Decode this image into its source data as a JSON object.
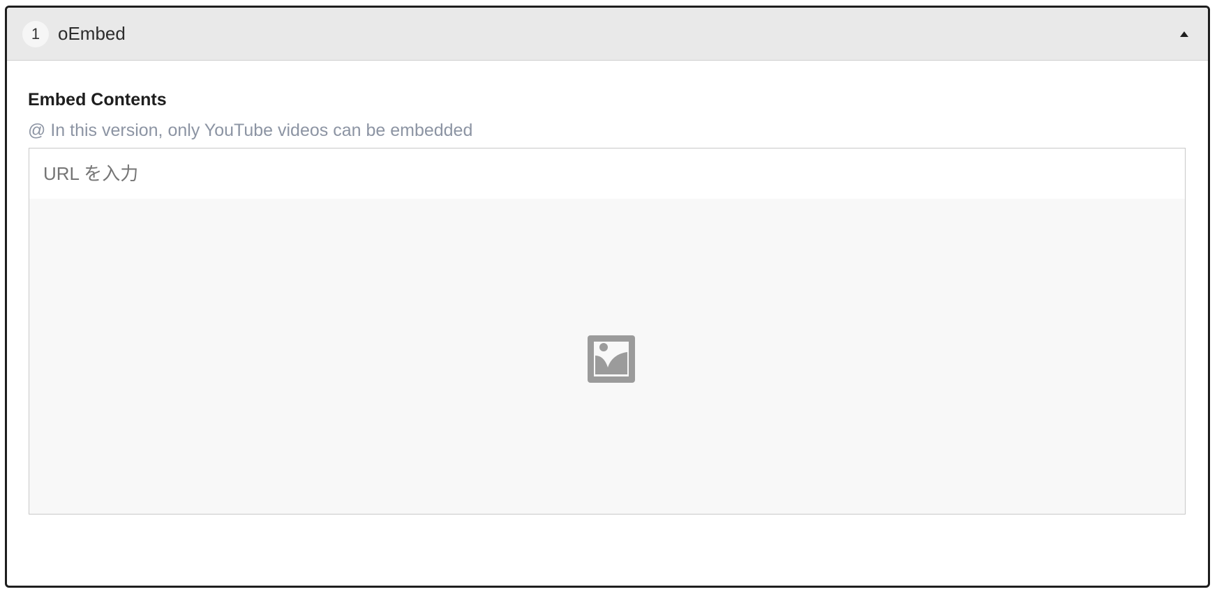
{
  "panel": {
    "index": "1",
    "title": "oEmbed",
    "toggle_icon": "triangle-up-icon"
  },
  "field": {
    "label": "Embed Contents",
    "help": "@ In this version, only YouTube videos can be embedded"
  },
  "url_input": {
    "placeholder": "URL を入力",
    "value": ""
  },
  "preview": {
    "icon": "image-placeholder-icon"
  },
  "colors": {
    "border": "#1e1e1e",
    "header_bg": "#e9e9e9",
    "help_text": "#8c94a3",
    "preview_bg": "#f8f8f8",
    "icon_gray": "#9b9b9b"
  }
}
